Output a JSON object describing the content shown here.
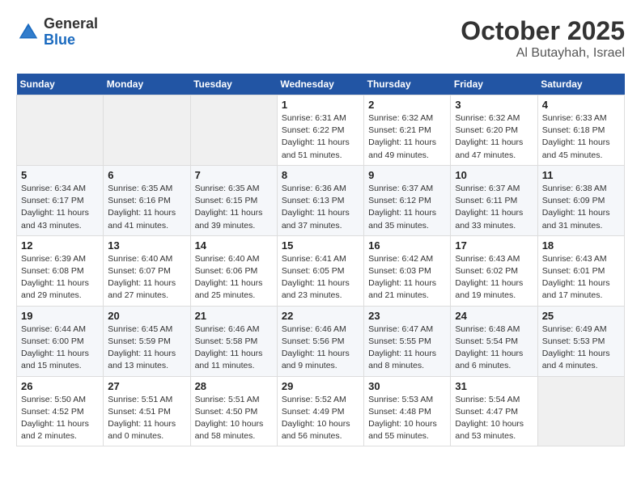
{
  "logo": {
    "general": "General",
    "blue": "Blue"
  },
  "header": {
    "month": "October 2025",
    "location": "Al Butayhah, Israel"
  },
  "weekdays": [
    "Sunday",
    "Monday",
    "Tuesday",
    "Wednesday",
    "Thursday",
    "Friday",
    "Saturday"
  ],
  "weeks": [
    [
      {
        "day": "",
        "info": ""
      },
      {
        "day": "",
        "info": ""
      },
      {
        "day": "",
        "info": ""
      },
      {
        "day": "1",
        "info": "Sunrise: 6:31 AM\nSunset: 6:22 PM\nDaylight: 11 hours\nand 51 minutes."
      },
      {
        "day": "2",
        "info": "Sunrise: 6:32 AM\nSunset: 6:21 PM\nDaylight: 11 hours\nand 49 minutes."
      },
      {
        "day": "3",
        "info": "Sunrise: 6:32 AM\nSunset: 6:20 PM\nDaylight: 11 hours\nand 47 minutes."
      },
      {
        "day": "4",
        "info": "Sunrise: 6:33 AM\nSunset: 6:18 PM\nDaylight: 11 hours\nand 45 minutes."
      }
    ],
    [
      {
        "day": "5",
        "info": "Sunrise: 6:34 AM\nSunset: 6:17 PM\nDaylight: 11 hours\nand 43 minutes."
      },
      {
        "day": "6",
        "info": "Sunrise: 6:35 AM\nSunset: 6:16 PM\nDaylight: 11 hours\nand 41 minutes."
      },
      {
        "day": "7",
        "info": "Sunrise: 6:35 AM\nSunset: 6:15 PM\nDaylight: 11 hours\nand 39 minutes."
      },
      {
        "day": "8",
        "info": "Sunrise: 6:36 AM\nSunset: 6:13 PM\nDaylight: 11 hours\nand 37 minutes."
      },
      {
        "day": "9",
        "info": "Sunrise: 6:37 AM\nSunset: 6:12 PM\nDaylight: 11 hours\nand 35 minutes."
      },
      {
        "day": "10",
        "info": "Sunrise: 6:37 AM\nSunset: 6:11 PM\nDaylight: 11 hours\nand 33 minutes."
      },
      {
        "day": "11",
        "info": "Sunrise: 6:38 AM\nSunset: 6:09 PM\nDaylight: 11 hours\nand 31 minutes."
      }
    ],
    [
      {
        "day": "12",
        "info": "Sunrise: 6:39 AM\nSunset: 6:08 PM\nDaylight: 11 hours\nand 29 minutes."
      },
      {
        "day": "13",
        "info": "Sunrise: 6:40 AM\nSunset: 6:07 PM\nDaylight: 11 hours\nand 27 minutes."
      },
      {
        "day": "14",
        "info": "Sunrise: 6:40 AM\nSunset: 6:06 PM\nDaylight: 11 hours\nand 25 minutes."
      },
      {
        "day": "15",
        "info": "Sunrise: 6:41 AM\nSunset: 6:05 PM\nDaylight: 11 hours\nand 23 minutes."
      },
      {
        "day": "16",
        "info": "Sunrise: 6:42 AM\nSunset: 6:03 PM\nDaylight: 11 hours\nand 21 minutes."
      },
      {
        "day": "17",
        "info": "Sunrise: 6:43 AM\nSunset: 6:02 PM\nDaylight: 11 hours\nand 19 minutes."
      },
      {
        "day": "18",
        "info": "Sunrise: 6:43 AM\nSunset: 6:01 PM\nDaylight: 11 hours\nand 17 minutes."
      }
    ],
    [
      {
        "day": "19",
        "info": "Sunrise: 6:44 AM\nSunset: 6:00 PM\nDaylight: 11 hours\nand 15 minutes."
      },
      {
        "day": "20",
        "info": "Sunrise: 6:45 AM\nSunset: 5:59 PM\nDaylight: 11 hours\nand 13 minutes."
      },
      {
        "day": "21",
        "info": "Sunrise: 6:46 AM\nSunset: 5:58 PM\nDaylight: 11 hours\nand 11 minutes."
      },
      {
        "day": "22",
        "info": "Sunrise: 6:46 AM\nSunset: 5:56 PM\nDaylight: 11 hours\nand 9 minutes."
      },
      {
        "day": "23",
        "info": "Sunrise: 6:47 AM\nSunset: 5:55 PM\nDaylight: 11 hours\nand 8 minutes."
      },
      {
        "day": "24",
        "info": "Sunrise: 6:48 AM\nSunset: 5:54 PM\nDaylight: 11 hours\nand 6 minutes."
      },
      {
        "day": "25",
        "info": "Sunrise: 6:49 AM\nSunset: 5:53 PM\nDaylight: 11 hours\nand 4 minutes."
      }
    ],
    [
      {
        "day": "26",
        "info": "Sunrise: 5:50 AM\nSunset: 4:52 PM\nDaylight: 11 hours\nand 2 minutes."
      },
      {
        "day": "27",
        "info": "Sunrise: 5:51 AM\nSunset: 4:51 PM\nDaylight: 11 hours\nand 0 minutes."
      },
      {
        "day": "28",
        "info": "Sunrise: 5:51 AM\nSunset: 4:50 PM\nDaylight: 10 hours\nand 58 minutes."
      },
      {
        "day": "29",
        "info": "Sunrise: 5:52 AM\nSunset: 4:49 PM\nDaylight: 10 hours\nand 56 minutes."
      },
      {
        "day": "30",
        "info": "Sunrise: 5:53 AM\nSunset: 4:48 PM\nDaylight: 10 hours\nand 55 minutes."
      },
      {
        "day": "31",
        "info": "Sunrise: 5:54 AM\nSunset: 4:47 PM\nDaylight: 10 hours\nand 53 minutes."
      },
      {
        "day": "",
        "info": ""
      }
    ]
  ]
}
